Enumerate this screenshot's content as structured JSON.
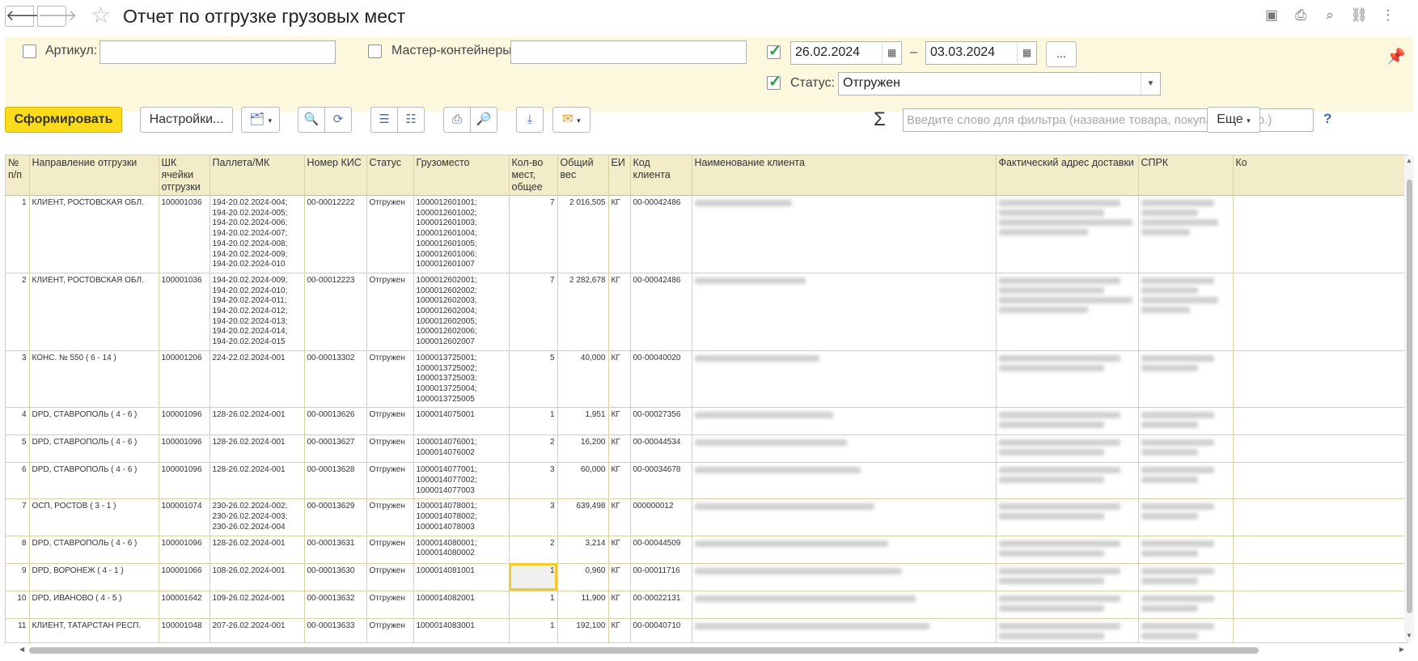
{
  "window": {
    "title": "Отчет по отгрузке грузовых мест"
  },
  "nav": {
    "back": "🡐",
    "forward": "🡒"
  },
  "filters": {
    "article": {
      "label": "Артикул:",
      "value": "",
      "checked": false
    },
    "master": {
      "label": "Мастер-контейнеры:",
      "value": "",
      "checked": false
    },
    "period": {
      "checked": true,
      "from": "26.02.2024",
      "dash": "–",
      "to": "03.03.2024",
      "more": "..."
    },
    "status": {
      "label": "Статус:",
      "value": "Отгружен",
      "checked": true
    }
  },
  "toolbar": {
    "generate": "Сформировать",
    "settings": "Настройки...",
    "search_placeholder": "Введите слово для фильтра (название товара, покупателя и пр.)",
    "help": "?",
    "more": "Еще",
    "sigma": "Σ"
  },
  "table": {
    "headers": [
      "№ п/п",
      "Направление отгрузки",
      "ШК ячейки отгрузки",
      "Паллета/МК",
      "Номер КИС",
      "Статус",
      "Грузоместо",
      "Кол-во мест, общее",
      "Общий вес",
      "ЕИ",
      "Код клиента",
      "Наименование клиента",
      "Фактический адрес доставки",
      "СПРК",
      "Ко"
    ],
    "rows": [
      {
        "n": "1",
        "dir": "КЛИЕНТ, РОСТОВСКАЯ ОБЛ.",
        "cell": "100001036",
        "pallets": [
          "194-20.02.2024-004;",
          "194-20.02.2024-005;",
          "194-20.02.2024-006;",
          "194-20.02.2024-007;",
          "194-20.02.2024-008;",
          "194-20.02.2024-009;",
          "194-20.02.2024-010"
        ],
        "kis": "00-00012222",
        "status": "Отгружен",
        "places": [
          "1000012601001;",
          "1000012601002;",
          "1000012601003;",
          "1000012601004;",
          "1000012601005;",
          "1000012601006;",
          "1000012601007"
        ],
        "count": "7",
        "weight": "2 016,505",
        "unit": "КГ",
        "client": "00-00042486"
      },
      {
        "n": "2",
        "dir": "КЛИЕНТ, РОСТОВСКАЯ ОБЛ.",
        "cell": "100001036",
        "pallets": [
          "194-20.02.2024-009;",
          "194-20.02.2024-010;",
          "194-20.02.2024-011;",
          "194-20.02.2024-012;",
          "194-20.02.2024-013;",
          "194-20.02.2024-014;",
          "194-20.02.2024-015"
        ],
        "kis": "00-00012223",
        "status": "Отгружен",
        "places": [
          "1000012602001;",
          "1000012602002;",
          "1000012602003;",
          "1000012602004;",
          "1000012602005;",
          "1000012602006;",
          "1000012602007"
        ],
        "count": "7",
        "weight": "2 282,678",
        "unit": "КГ",
        "client": "00-00042486"
      },
      {
        "n": "3",
        "dir": "КОНС. № 550 ( 6 - 14 )",
        "cell": "100001206",
        "pallets": [
          "224-22.02.2024-001"
        ],
        "kis": "00-00013302",
        "status": "Отгружен",
        "places": [
          "1000013725001;",
          "1000013725002;",
          "1000013725003;",
          "1000013725004;",
          "1000013725005"
        ],
        "count": "5",
        "weight": "40,000",
        "unit": "КГ",
        "client": "00-00040020"
      },
      {
        "n": "4",
        "dir": "DPD, СТАВРОПОЛЬ ( 4 - 6 )",
        "cell": "100001096",
        "pallets": [
          "128-26.02.2024-001"
        ],
        "kis": "00-00013626",
        "status": "Отгружен",
        "places": [
          "1000014075001"
        ],
        "count": "1",
        "weight": "1,951",
        "unit": "КГ",
        "client": "00-00027356"
      },
      {
        "n": "5",
        "dir": "DPD, СТАВРОПОЛЬ ( 4 - 6 )",
        "cell": "100001096",
        "pallets": [
          "128-26.02.2024-001"
        ],
        "kis": "00-00013627",
        "status": "Отгружен",
        "places": [
          "1000014076001;",
          "1000014076002"
        ],
        "count": "2",
        "weight": "16,200",
        "unit": "КГ",
        "client": "00-00044534"
      },
      {
        "n": "6",
        "dir": "DPD, СТАВРОПОЛЬ ( 4 - 6 )",
        "cell": "100001096",
        "pallets": [
          "128-26.02.2024-001"
        ],
        "kis": "00-00013628",
        "status": "Отгружен",
        "places": [
          "1000014077001;",
          "1000014077002;",
          "1000014077003"
        ],
        "count": "3",
        "weight": "60,000",
        "unit": "КГ",
        "client": "00-00034678"
      },
      {
        "n": "7",
        "dir": "ОСП, РОСТОВ ( 3 - 1 )",
        "cell": "100001074",
        "pallets": [
          "230-26.02.2024-002;",
          "230-26.02.2024-003;",
          "230-26.02.2024-004"
        ],
        "kis": "00-00013629",
        "status": "Отгружен",
        "places": [
          "1000014078001;",
          "1000014078002;",
          "1000014078003"
        ],
        "count": "3",
        "weight": "639,498",
        "unit": "КГ",
        "client": "000000012"
      },
      {
        "n": "8",
        "dir": "DPD, СТАВРОПОЛЬ ( 4 - 6 )",
        "cell": "100001096",
        "pallets": [
          "128-26.02.2024-001"
        ],
        "kis": "00-00013631",
        "status": "Отгружен",
        "places": [
          "1000014080001;",
          "1000014080002"
        ],
        "count": "2",
        "weight": "3,214",
        "unit": "КГ",
        "client": "00-00044509"
      },
      {
        "n": "9",
        "dir": "DPD, ВОРОНЕЖ ( 4 - 1 )",
        "cell": "100001066",
        "pallets": [
          "108-26.02.2024-001"
        ],
        "kis": "00-00013630",
        "status": "Отгружен",
        "places": [
          "1000014081001"
        ],
        "count": "1",
        "weight": "0,960",
        "unit": "КГ",
        "client": "00-00011716"
      },
      {
        "n": "10",
        "dir": "DPD, ИВАНОВО ( 4 - 5 )",
        "cell": "100001642",
        "pallets": [
          "109-26.02.2024-001"
        ],
        "kis": "00-00013632",
        "status": "Отгружен",
        "places": [
          "1000014082001"
        ],
        "count": "1",
        "weight": "11,900",
        "unit": "КГ",
        "client": "00-00022131"
      },
      {
        "n": "11",
        "dir": "КЛИЕНТ, ТАТАРСТАН РЕСП.",
        "cell": "100001048",
        "pallets": [
          "207-26.02.2024-001"
        ],
        "kis": "00-00013633",
        "status": "Отгружен",
        "places": [
          "1000014083001"
        ],
        "count": "1",
        "weight": "192,100",
        "unit": "КГ",
        "client": "00-00040710"
      }
    ]
  }
}
